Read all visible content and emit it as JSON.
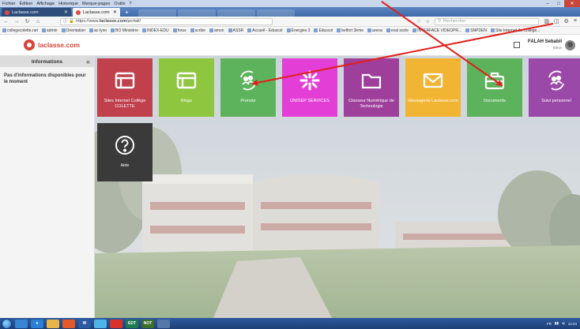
{
  "browser": {
    "menu": [
      "Fichier",
      "Édition",
      "Affichage",
      "Historique",
      "Marque-pages",
      "Outils",
      "?"
    ],
    "tabs": [
      {
        "label": "Laclasse.com",
        "active": false
      },
      {
        "label": "Laclasse.com",
        "active": true
      }
    ],
    "new_tab": "+",
    "url_secure": "https://www.",
    "url_domain": "laclasse.com",
    "url_path": "/portail/",
    "search_placeholder": "Rechercher",
    "bookmarks": [
      "collegecolette.net",
      "admin",
      "Orientation",
      "ac-lyon",
      "BO Ministère",
      "INDEX-EDU",
      "forus",
      "scribe",
      "amon",
      "ASSR",
      "Accueil - Éduscol",
      "Énergies 3",
      "Eduscol",
      "belfort 3ème",
      "arena",
      "eval socle",
      "INTERFACE VIDEOPR...",
      "SNPDEN",
      "Site Internet du Collège..."
    ]
  },
  "site": {
    "logo_text": "laclasse.com",
    "user_name": "FALAH Sebabil",
    "user_role": "Élève"
  },
  "sidebar": {
    "title": "Informations",
    "collapse_glyph": "«",
    "message": "Pas d'informations disponibles pour le moment"
  },
  "tiles": [
    {
      "label": "Sites Internet Collège COLETTE",
      "color": "#c0404c",
      "icon": "window-icon"
    },
    {
      "label": "Blogs",
      "color": "#8ec63f",
      "icon": "window-icon"
    },
    {
      "label": "Pronote",
      "color": "#5db35b",
      "icon": "people-cycle-icon"
    },
    {
      "label": "ONISEP SERVICES",
      "color": "#e33fd7",
      "icon": "asterisk-icon"
    },
    {
      "label": "Classeur Numérique de Technologie",
      "color": "#9e3f9b",
      "icon": "folder-icon"
    },
    {
      "label": "Messagerie Laclasse.com",
      "color": "#f2b433",
      "icon": "envelope-icon"
    },
    {
      "label": "Documents",
      "color": "#5db35b",
      "icon": "briefcase-icon"
    },
    {
      "label": "Suivi personnel",
      "color": "#9b49a8",
      "icon": "people-cycle-icon"
    },
    {
      "label": "Aide",
      "color": "#3a3a3a",
      "icon": "help-icon"
    }
  ],
  "annotations": {
    "arrow_color": "#e0201c"
  },
  "taskbar": {
    "items": [
      {
        "label": "",
        "color": "#3a84d6",
        "icon": "explorer-icon"
      },
      {
        "label": "e",
        "color": "#2b7fd4",
        "icon": "ie-icon"
      },
      {
        "label": "",
        "color": "#e8b54a",
        "icon": "folder-icon"
      },
      {
        "label": "",
        "color": "#e35a2a",
        "icon": "firefox-icon"
      },
      {
        "label": "W",
        "color": "#2c5aa0",
        "icon": "word-icon"
      },
      {
        "label": "",
        "color": "#4db3e8",
        "icon": "app-icon"
      },
      {
        "label": "",
        "color": "#d7332b",
        "icon": "app-icon"
      },
      {
        "label": "EDT",
        "color": "#1f7a52",
        "icon": "app-icon"
      },
      {
        "label": "NOT",
        "color": "#3a6e2e",
        "icon": "app-icon"
      },
      {
        "label": "",
        "color": "#5577aa",
        "icon": "app-icon"
      }
    ],
    "lang": "FR",
    "time": "12:24"
  }
}
